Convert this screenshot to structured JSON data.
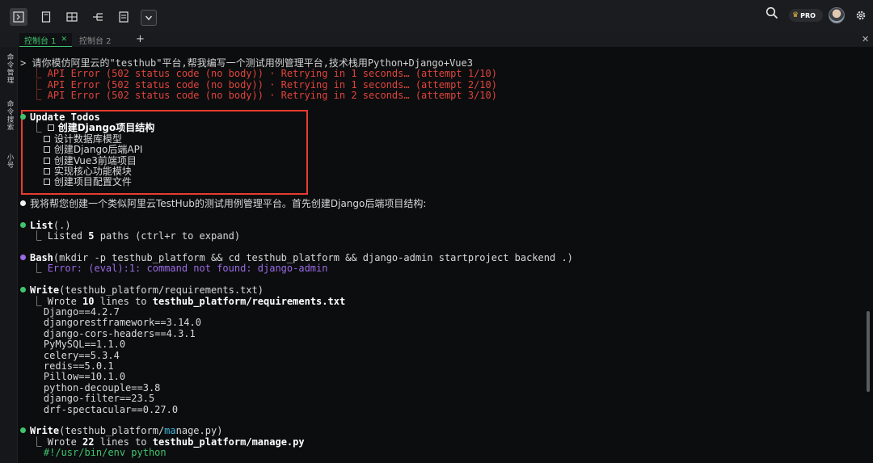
{
  "toolbar": {
    "buttons": [
      {
        "name": "terminal-icon",
        "active": true
      },
      {
        "name": "document-icon",
        "active": false
      },
      {
        "name": "grid-icon",
        "active": false
      },
      {
        "name": "tree-icon",
        "active": false
      },
      {
        "name": "list-icon",
        "active": false
      },
      {
        "name": "chevron-down-icon",
        "active": false
      }
    ],
    "pro_label": "PRO"
  },
  "tabs": [
    {
      "label": "控制台 1",
      "active": true
    },
    {
      "label": "控制台 2",
      "active": false
    }
  ],
  "rail": [
    "命令管理",
    "命令搜索",
    "小号"
  ],
  "terminal": {
    "prompt": "> 请你模仿阿里云的\"testhub\"平台,帮我编写一个测试用例管理平台,技术栈用Python+Django+Vue3",
    "errors": [
      "  ⎿ API Error (502 status code (no body)) · Retrying in 1 seconds… (attempt 1/10)",
      "  ⎿ API Error (502 status code (no body)) · Retrying in 1 seconds… (attempt 2/10)",
      "  ⎿ API Error (502 status code (no body)) · Retrying in 2 seconds… (attempt 3/10)"
    ],
    "todos_title": "Update Todos",
    "todos": [
      "创建Django项目结构",
      "设计数据库模型",
      "创建Django后端API",
      "创建Vue3前端项目",
      "实现核心功能模块",
      "创建项目配置文件"
    ],
    "message": "我将帮您创建一个类似阿里云TestHub的测试用例管理平台。首先创建Django后端项目结构:",
    "list_cmd": "List",
    "list_arg": "(.)",
    "list_result_pre": "Listed ",
    "list_result_num": "5",
    "list_result_post": " paths (ctrl+r to expand)",
    "bash_cmd": "Bash",
    "bash_arg": "(mkdir -p testhub_platform && cd testhub_platform && django-admin startproject backend .)",
    "bash_error": "Error: (eval):1: command not found: django-admin",
    "write1_cmd": "Write",
    "write1_arg": "(testhub_platform/requirements.txt)",
    "write1_pre": "Wrote ",
    "write1_num": "10",
    "write1_mid": " lines to ",
    "write1_file": "testhub_platform/requirements.txt",
    "requirements": [
      "Django==4.2.7",
      "djangorestframework==3.14.0",
      "django-cors-headers==4.3.1",
      "PyMySQL==1.1.0",
      "celery==5.3.4",
      "redis==5.0.1",
      "Pillow==10.1.0",
      "python-decouple==3.8",
      "django-filter==23.5",
      "drf-spectacular==0.27.0"
    ],
    "write2_cmd": "Write",
    "write2_arg_a": "(testhub_platform/",
    "write2_arg_b": "ma",
    "write2_arg_c": "nage.py)",
    "write2_pre": "Wrote ",
    "write2_num": "22",
    "write2_mid": " lines to ",
    "write2_file": "testhub_platform/manage.py",
    "shebang": "#!/usr/bin/env python"
  },
  "colors": {
    "accent": "#3ec46d",
    "error": "#e0443b",
    "bash": "#9b6ae6",
    "highlight": "#e63c2f"
  }
}
